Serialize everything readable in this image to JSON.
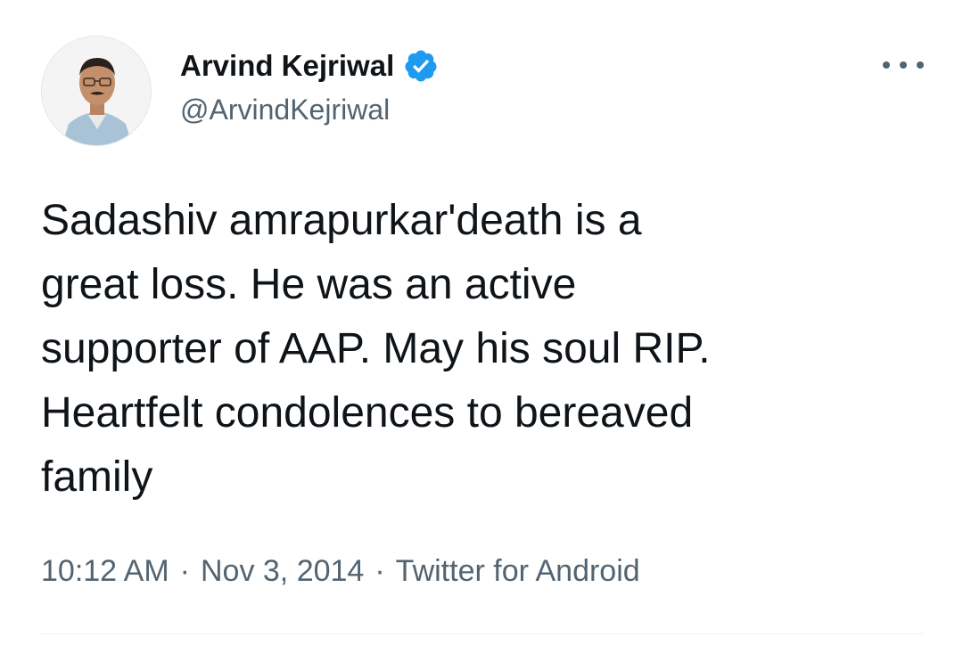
{
  "author": {
    "name": "Arvind Kejriwal",
    "handle": "@ArvindKejriwal",
    "verified": true,
    "avatar_icon": "profile-photo"
  },
  "tweet": {
    "text": "Sadashiv amrapurkar'death is a\ngreat loss. He was an active\nsupporter of AAP. May his soul RIP.\nHeartfelt condolences to bereaved\nfamily"
  },
  "meta": {
    "time": "10:12 AM",
    "separator": "·",
    "date": "Nov 3, 2014",
    "source": "Twitter for Android"
  },
  "colors": {
    "verified": "#1d9bf0",
    "text_primary": "#0f1419",
    "text_secondary": "#536471"
  },
  "icons": {
    "more": "more-horizontal-icon",
    "verified": "verified-badge-icon"
  }
}
